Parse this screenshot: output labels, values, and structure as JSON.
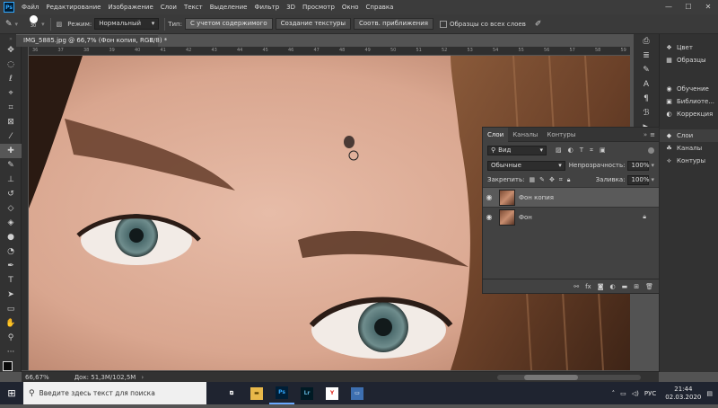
{
  "app": {
    "name": "Adobe Photoshop",
    "logo_text": "Ps"
  },
  "menu": {
    "items": [
      "Файл",
      "Редактирование",
      "Изображение",
      "Слои",
      "Текст",
      "Выделение",
      "Фильтр",
      "3D",
      "Просмотр",
      "Окно",
      "Справка"
    ]
  },
  "window_controls": {
    "minimize": "—",
    "maximize": "☐",
    "close": "✕"
  },
  "options_bar": {
    "brush_size": "30",
    "mode_label": "Режим:",
    "mode_value": "Нормальный",
    "type_label": "Тип:",
    "type_buttons": [
      "С учетом содержимого",
      "Создание текстуры",
      "Соотв. приближения"
    ],
    "sample_all_label": "Образцы со всех слоев"
  },
  "document": {
    "tab_title": "IMG_5885.jpg @ 66,7% (Фон копия, RGB/8) *",
    "close": "✕"
  },
  "ruler": {
    "numbers": [
      "36",
      "37",
      "38",
      "39",
      "40",
      "41",
      "42",
      "43",
      "44",
      "45",
      "46",
      "47",
      "48",
      "49",
      "50",
      "51",
      "52",
      "53",
      "54",
      "55",
      "56",
      "57",
      "58",
      "59"
    ]
  },
  "side_panel": {
    "groups": [
      [
        {
          "icon": "palette-icon",
          "glyph": "❖",
          "label": "Цвет"
        },
        {
          "icon": "swatches-icon",
          "glyph": "▦",
          "label": "Образцы"
        }
      ],
      [
        {
          "icon": "bulb-icon",
          "glyph": "◉",
          "label": "Обучение"
        },
        {
          "icon": "library-icon",
          "glyph": "▣",
          "label": "Библиоте..."
        },
        {
          "icon": "adjustment-icon",
          "glyph": "◐",
          "label": "Коррекция"
        }
      ],
      [
        {
          "icon": "layers-icon",
          "glyph": "◆",
          "label": "Слои",
          "active": true
        },
        {
          "icon": "channels-icon",
          "glyph": "☘",
          "label": "Каналы"
        },
        {
          "icon": "paths-icon",
          "glyph": "⟡",
          "label": "Контуры"
        }
      ]
    ]
  },
  "layers_panel": {
    "tabs": [
      "Слои",
      "Каналы",
      "Контуры"
    ],
    "active_tab": "Слои",
    "filter_value": "Вид",
    "blend_mode": "Обычные",
    "opacity_label": "Непрозрачность:",
    "opacity_value": "100%",
    "lock_label": "Закрепить:",
    "fill_label": "Заливка:",
    "fill_value": "100%",
    "layers": [
      {
        "name": "Фон копия",
        "selected": true,
        "locked": false
      },
      {
        "name": "Фон",
        "selected": false,
        "locked": true
      }
    ]
  },
  "status_bar": {
    "zoom": "66,67%",
    "doc_info": "Док: 51,3M/102,5M"
  },
  "taskbar": {
    "search_placeholder": "Введите здесь текст для поиска",
    "apps": [
      {
        "icon": "task-view-icon",
        "glyph": "⧉",
        "bg": "transparent",
        "fg": "#ffffff"
      },
      {
        "icon": "file-explorer-icon",
        "glyph": "▬",
        "bg": "#e8b84a",
        "fg": "#5a4000"
      },
      {
        "icon": "photoshop-taskbar-icon",
        "glyph": "Ps",
        "bg": "#001e36",
        "fg": "#31a8ff",
        "running": true
      },
      {
        "icon": "lightroom-icon",
        "glyph": "Lr",
        "bg": "#001a24",
        "fg": "#5fb2d8"
      },
      {
        "icon": "yandex-browser-icon",
        "glyph": "Y",
        "bg": "#ffffff",
        "fg": "#e0241b"
      },
      {
        "icon": "unknown-app-icon",
        "glyph": "▭",
        "bg": "#3d6fb0",
        "fg": "#ffffff"
      }
    ],
    "language": "РУС",
    "time": "21:44",
    "date": "02.03.2020"
  }
}
